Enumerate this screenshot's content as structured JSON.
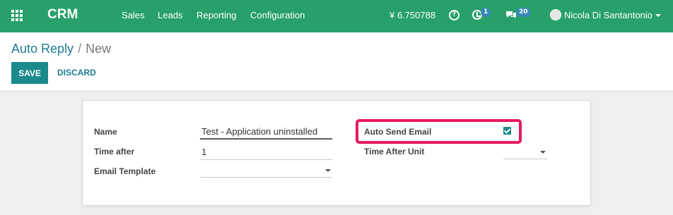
{
  "navbar": {
    "brand": "CRM",
    "menu": [
      "Sales",
      "Leads",
      "Reporting",
      "Configuration"
    ],
    "currency_balance": "¥ 6.750788",
    "activity_count": "1",
    "message_count": "20",
    "user_name": "Nicola Di Santantonio"
  },
  "breadcrumb": {
    "parent": "Auto Reply",
    "separator": "/",
    "current": "New"
  },
  "buttons": {
    "save": "SAVE",
    "discard": "DISCARD"
  },
  "form": {
    "name": {
      "label": "Name",
      "value": "Test - Application uninstalled"
    },
    "time_after": {
      "label": "Time after",
      "value": "1"
    },
    "email_template": {
      "label": "Email Template",
      "value": ""
    },
    "auto_send_email": {
      "label": "Auto Send Email",
      "checked": true
    },
    "time_after_unit": {
      "label": "Time After Unit",
      "value": ""
    }
  },
  "colors": {
    "navbar": "#27a169",
    "primary": "#1b8a8c",
    "link": "#1c7d92",
    "highlight": "#e8195f"
  },
  "icons": [
    "apps-grid-icon",
    "help-icon",
    "activity-clock-icon",
    "chat-icon",
    "avatar",
    "caret-down-icon"
  ]
}
